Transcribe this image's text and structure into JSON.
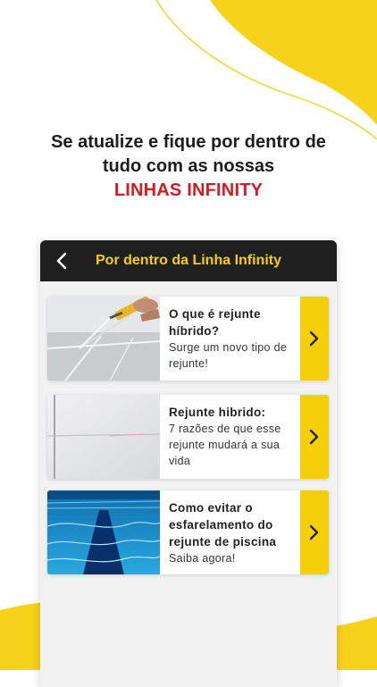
{
  "colors": {
    "accent_yellow": "#f6cf0b",
    "accent_red": "#d71920",
    "appbar_bg": "#1f1f1f"
  },
  "headline": {
    "line1": "Se atualize e fique por dentro de",
    "line2": "tudo com as nossas",
    "brand": "LINHAS INFINITY"
  },
  "appbar": {
    "title": "Por dentro da Linha Infinity",
    "back_icon": "chevron-left-icon"
  },
  "articles": [
    {
      "title": "O que é rejunte híbrido?",
      "desc": "Surge um novo tipo de rejunte!",
      "arrow_icon": "chevron-right-icon"
    },
    {
      "title": "Rejunte hibrido:",
      "desc": "7 razões de que esse rejunte mudará a sua vida",
      "arrow_icon": "chevron-right-icon"
    },
    {
      "title": "Como evitar o esfarelamento do rejunte de piscina",
      "desc": "Saiba agora!",
      "arrow_icon": "chevron-right-icon"
    }
  ]
}
